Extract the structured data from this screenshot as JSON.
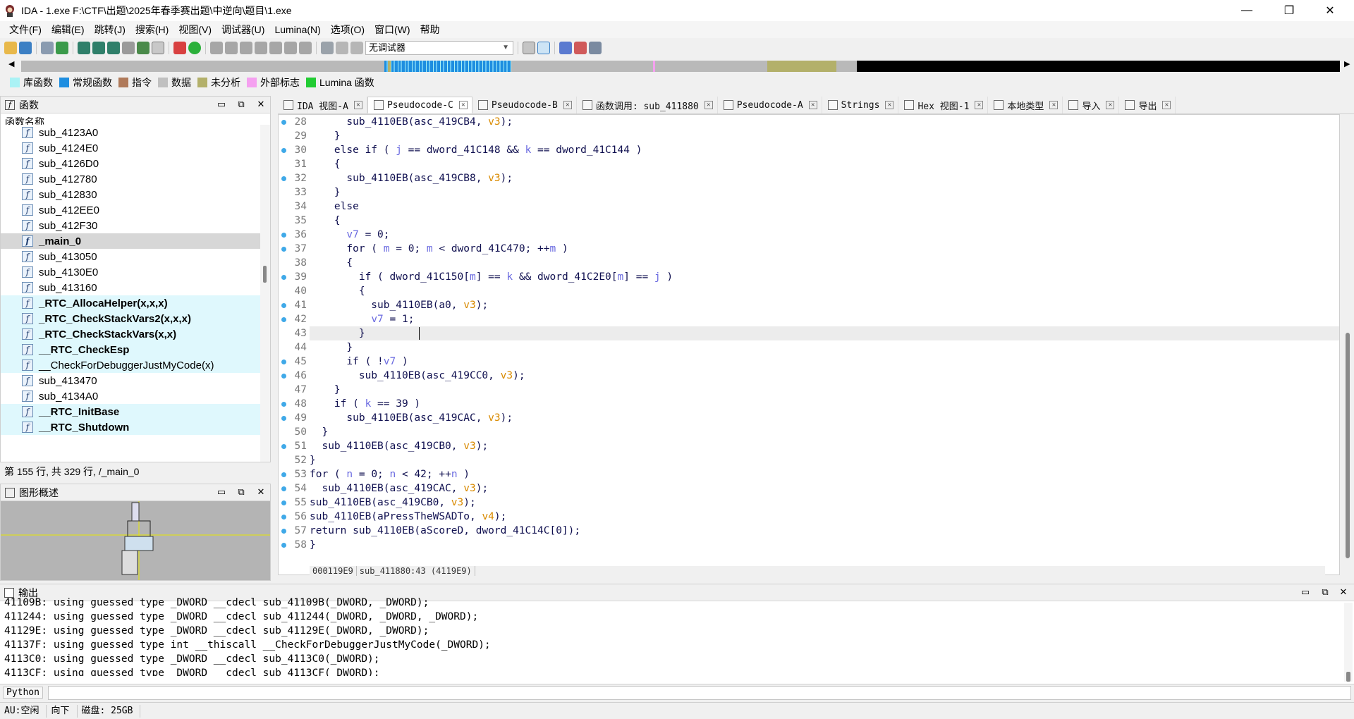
{
  "window": {
    "title": "IDA - 1.exe F:\\CTF\\出题\\2025年春季赛出题\\中逆向\\题目\\1.exe",
    "minimize": "—",
    "maximize": "❐",
    "close": "✕"
  },
  "menu": [
    "文件(F)",
    "编辑(E)",
    "跳转(J)",
    "搜索(H)",
    "视图(V)",
    "调试器(U)",
    "Lumina(N)",
    "选项(O)",
    "窗口(W)",
    "帮助"
  ],
  "toolbar": {
    "debugger_label": "无调试器"
  },
  "legend": [
    {
      "label": "库函数",
      "color": "#aaf2f5"
    },
    {
      "label": "常规函数",
      "color": "#1e8ee0"
    },
    {
      "label": "指令",
      "color": "#b07a5a"
    },
    {
      "label": "数据",
      "color": "#c0c0c0"
    },
    {
      "label": "未分析",
      "color": "#b3b06a"
    },
    {
      "label": "外部标志",
      "color": "#f5a0f0"
    },
    {
      "label": "Lumina 函数",
      "color": "#22cc33"
    }
  ],
  "functions_panel": {
    "title": "函数",
    "column": "函数名称",
    "items": [
      {
        "name": "sub_4123A0",
        "kind": "normal"
      },
      {
        "name": "sub_4124E0",
        "kind": "normal"
      },
      {
        "name": "sub_4126D0",
        "kind": "normal"
      },
      {
        "name": "sub_412780",
        "kind": "normal"
      },
      {
        "name": "sub_412830",
        "kind": "normal"
      },
      {
        "name": "sub_412EE0",
        "kind": "normal"
      },
      {
        "name": "sub_412F30",
        "kind": "normal"
      },
      {
        "name": "_main_0",
        "kind": "selected"
      },
      {
        "name": "sub_413050",
        "kind": "normal"
      },
      {
        "name": "sub_4130E0",
        "kind": "normal"
      },
      {
        "name": "sub_413160",
        "kind": "normal"
      },
      {
        "name": "_RTC_AllocaHelper(x,x,x)",
        "kind": "lib"
      },
      {
        "name": "_RTC_CheckStackVars2(x,x,x)",
        "kind": "lib"
      },
      {
        "name": "_RTC_CheckStackVars(x,x)",
        "kind": "lib"
      },
      {
        "name": "__RTC_CheckEsp",
        "kind": "lib"
      },
      {
        "name": "__CheckForDebuggerJustMyCode(x)",
        "kind": "lib-plain"
      },
      {
        "name": "sub_413470",
        "kind": "normal"
      },
      {
        "name": "sub_4134A0",
        "kind": "normal"
      },
      {
        "name": "__RTC_InitBase",
        "kind": "lib"
      },
      {
        "name": "__RTC_Shutdown",
        "kind": "lib"
      }
    ],
    "status": "第 155 行, 共 329 行, /_main_0"
  },
  "graph_panel": {
    "title": "图形概述"
  },
  "tabs": [
    {
      "label": "IDA 视图-A",
      "icon": "ida-view-icon"
    },
    {
      "label": "Pseudocode-C",
      "icon": "pseudocode-icon",
      "active": true
    },
    {
      "label": "Pseudocode-B",
      "icon": "pseudocode-icon"
    },
    {
      "label": "函数调用: sub_411880",
      "icon": "call-graph-icon"
    },
    {
      "label": "Pseudocode-A",
      "icon": "pseudocode-icon"
    },
    {
      "label": "Strings",
      "icon": "strings-icon"
    },
    {
      "label": "Hex 视图-1",
      "icon": "hex-icon"
    },
    {
      "label": "本地类型",
      "icon": "local-types-icon"
    },
    {
      "label": "导入",
      "icon": "imports-icon"
    },
    {
      "label": "导出",
      "icon": "exports-icon"
    }
  ],
  "code": [
    {
      "n": "28",
      "dot": true,
      "t": "      sub_4110EB(asc_419CB4, v3);"
    },
    {
      "n": "29",
      "dot": false,
      "t": "    }"
    },
    {
      "n": "30",
      "dot": true,
      "t": "    else if ( j == dword_41C148 && k == dword_41C144 )"
    },
    {
      "n": "31",
      "dot": false,
      "t": "    {"
    },
    {
      "n": "32",
      "dot": true,
      "t": "      sub_4110EB(asc_419CB8, v3);"
    },
    {
      "n": "33",
      "dot": false,
      "t": "    }"
    },
    {
      "n": "34",
      "dot": false,
      "t": "    else"
    },
    {
      "n": "35",
      "dot": false,
      "t": "    {"
    },
    {
      "n": "36",
      "dot": true,
      "t": "      v7 = 0;"
    },
    {
      "n": "37",
      "dot": true,
      "t": "      for ( m = 0; m < dword_41C470; ++m )"
    },
    {
      "n": "38",
      "dot": false,
      "t": "      {"
    },
    {
      "n": "39",
      "dot": true,
      "t": "        if ( dword_41C150[m] == k && dword_41C2E0[m] == j )"
    },
    {
      "n": "40",
      "dot": false,
      "t": "        {"
    },
    {
      "n": "41",
      "dot": true,
      "t": "          sub_4110EB(a0, v3);"
    },
    {
      "n": "42",
      "dot": true,
      "t": "          v7 = 1;"
    },
    {
      "n": "43",
      "dot": false,
      "t": "        }"
    },
    {
      "n": "44",
      "dot": false,
      "t": "      }"
    },
    {
      "n": "45",
      "dot": true,
      "t": "      if ( !v7 )"
    },
    {
      "n": "46",
      "dot": true,
      "t": "        sub_4110EB(asc_419CC0, v3);"
    },
    {
      "n": "47",
      "dot": false,
      "t": "    }"
    },
    {
      "n": "48",
      "dot": true,
      "t": "    if ( k == 39 )"
    },
    {
      "n": "49",
      "dot": true,
      "t": "      sub_4110EB(asc_419CAC, v3);"
    },
    {
      "n": "50",
      "dot": false,
      "t": "  }"
    },
    {
      "n": "51",
      "dot": true,
      "t": "  sub_4110EB(asc_419CB0, v3);"
    },
    {
      "n": "52",
      "dot": false,
      "t": "}"
    },
    {
      "n": "53",
      "dot": true,
      "t": "for ( n = 0; n < 42; ++n )"
    },
    {
      "n": "54",
      "dot": true,
      "t": "  sub_4110EB(asc_419CAC, v3);"
    },
    {
      "n": "55",
      "dot": true,
      "t": "sub_4110EB(asc_419CB0, v3);"
    },
    {
      "n": "56",
      "dot": true,
      "t": "sub_4110EB(aPressTheWSADTo, v4);"
    },
    {
      "n": "57",
      "dot": true,
      "t": "return sub_4110EB(aScoreD, dword_41C14C[0]);"
    },
    {
      "n": "58",
      "dot": true,
      "t": "}"
    }
  ],
  "code_footer": {
    "address": "000119E9",
    "location": "sub_411880:43 (4119E9)"
  },
  "output": {
    "title": "输出",
    "lines": [
      "41109B: using guessed type _DWORD __cdecl sub_41109B(_DWORD, _DWORD);",
      "411244: using guessed type _DWORD __cdecl sub_411244(_DWORD, _DWORD, _DWORD);",
      "41129E: using guessed type _DWORD __cdecl sub_41129E(_DWORD, _DWORD);",
      "41137F: using guessed type int __thiscall __CheckForDebuggerJustMyCode(_DWORD);",
      "4113C0: using guessed type _DWORD __cdecl sub_4113C0(_DWORD);",
      "4113CF: using guessed type _DWORD __cdecl sub_4113CF(_DWORD);"
    ]
  },
  "python_label": "Python",
  "statusbar": {
    "au": "AU:空闲",
    "dir": "向下",
    "disk": "磁盘: 25GB"
  }
}
